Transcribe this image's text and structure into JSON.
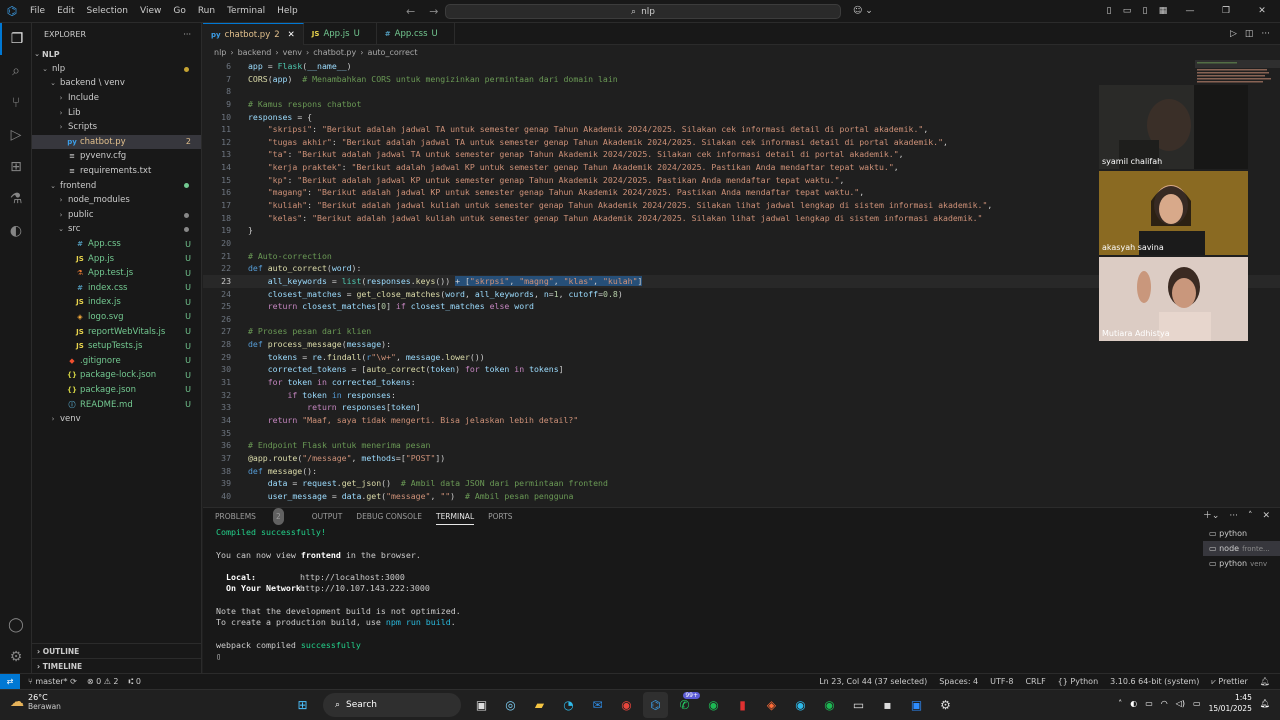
{
  "window": {
    "menu": [
      "File",
      "Edit",
      "Selection",
      "View",
      "Go",
      "Run",
      "Terminal",
      "Help"
    ],
    "search_text": "nlp",
    "nav_back": "←",
    "nav_forward": "→"
  },
  "explorer": {
    "title": "EXPLORER",
    "root": "NLP",
    "items": [
      {
        "label": "nlp",
        "indent": 1,
        "chev": "⌄",
        "icon": "",
        "color": "#cccccc",
        "badge": "",
        "dot": "#c5a332"
      },
      {
        "label": "backend \\ venv",
        "indent": 2,
        "chev": "⌄",
        "icon": "",
        "color": "#cccccc",
        "badge": "",
        "dot": ""
      },
      {
        "label": "Include",
        "indent": 3,
        "chev": "›",
        "icon": "",
        "color": "#cccccc",
        "badge": "",
        "dot": ""
      },
      {
        "label": "Lib",
        "indent": 3,
        "chev": "›",
        "icon": "",
        "color": "#cccccc",
        "badge": "",
        "dot": ""
      },
      {
        "label": "Scripts",
        "indent": 3,
        "chev": "›",
        "icon": "",
        "color": "#cccccc",
        "badge": "",
        "dot": ""
      },
      {
        "label": "chatbot.py",
        "indent": 3,
        "chev": "",
        "icon": "py",
        "color": "#e2c08d",
        "badge": "2",
        "dot": "",
        "sel": true
      },
      {
        "label": "pyvenv.cfg",
        "indent": 3,
        "chev": "",
        "icon": "≡",
        "color": "#cccccc",
        "badge": "",
        "dot": ""
      },
      {
        "label": "requirements.txt",
        "indent": 3,
        "chev": "",
        "icon": "≡",
        "color": "#cccccc",
        "badge": "",
        "dot": ""
      },
      {
        "label": "frontend",
        "indent": 2,
        "chev": "⌄",
        "icon": "",
        "color": "#cccccc",
        "badge": "",
        "dot": "#73c991"
      },
      {
        "label": "node_modules",
        "indent": 3,
        "chev": "›",
        "icon": "",
        "color": "#cccccc",
        "badge": "",
        "dot": ""
      },
      {
        "label": "public",
        "indent": 3,
        "chev": "›",
        "icon": "",
        "color": "#cccccc",
        "badge": "",
        "dot": "#888888"
      },
      {
        "label": "src",
        "indent": 3,
        "chev": "⌄",
        "icon": "",
        "color": "#cccccc",
        "badge": "",
        "dot": "#888888"
      },
      {
        "label": "App.css",
        "indent": 4,
        "chev": "",
        "icon": "#",
        "color": "#cccccc",
        "badge": "U",
        "dot": ""
      },
      {
        "label": "App.js",
        "indent": 4,
        "chev": "",
        "icon": "JS",
        "color": "#cccccc",
        "badge": "U",
        "dot": ""
      },
      {
        "label": "App.test.js",
        "indent": 4,
        "chev": "",
        "icon": "⚗",
        "color": "#cccccc",
        "badge": "U",
        "dot": ""
      },
      {
        "label": "index.css",
        "indent": 4,
        "chev": "",
        "icon": "#",
        "color": "#cccccc",
        "badge": "U",
        "dot": ""
      },
      {
        "label": "index.js",
        "indent": 4,
        "chev": "",
        "icon": "JS",
        "color": "#cccccc",
        "badge": "U",
        "dot": ""
      },
      {
        "label": "logo.svg",
        "indent": 4,
        "chev": "",
        "icon": "◈",
        "color": "#cccccc",
        "badge": "U",
        "dot": ""
      },
      {
        "label": "reportWebVitals.js",
        "indent": 4,
        "chev": "",
        "icon": "JS",
        "color": "#cccccc",
        "badge": "U",
        "dot": ""
      },
      {
        "label": "setupTests.js",
        "indent": 4,
        "chev": "",
        "icon": "JS",
        "color": "#cccccc",
        "badge": "U",
        "dot": ""
      },
      {
        "label": ".gitignore",
        "indent": 3,
        "chev": "",
        "icon": "◆",
        "color": "#cccccc",
        "badge": "U",
        "dot": ""
      },
      {
        "label": "package-lock.json",
        "indent": 3,
        "chev": "",
        "icon": "{}",
        "color": "#cccccc",
        "badge": "U",
        "dot": ""
      },
      {
        "label": "package.json",
        "indent": 3,
        "chev": "",
        "icon": "{}",
        "color": "#cccccc",
        "badge": "U",
        "dot": ""
      },
      {
        "label": "README.md",
        "indent": 3,
        "chev": "",
        "icon": "ⓘ",
        "color": "#cccccc",
        "badge": "U",
        "dot": ""
      },
      {
        "label": "venv",
        "indent": 2,
        "chev": "›",
        "icon": "",
        "color": "#cccccc",
        "badge": "",
        "dot": ""
      }
    ],
    "outline": "OUTLINE",
    "timeline": "TIMELINE"
  },
  "tabs": [
    {
      "label": "chatbot.py",
      "icon": "py",
      "suffix": "2",
      "active": true
    },
    {
      "label": "App.js",
      "icon": "JS",
      "suffix": "U",
      "active": false
    },
    {
      "label": "App.css",
      "icon": "#",
      "suffix": "U",
      "active": false
    }
  ],
  "breadcrumb": [
    "nlp",
    "backend",
    "venv",
    "chatbot.py",
    "auto_correct"
  ],
  "code_lines": [
    {
      "n": "6",
      "html": "<span class='var'>app</span> <span class='op'>=</span> <span class='cls'>Flask</span>(<span class='var'>__name__</span>)"
    },
    {
      "n": "7",
      "html": "<span class='fn'>CORS</span>(<span class='var'>app</span>)  <span class='cm'># Menambahkan CORS untuk mengizinkan permintaan dari domain lain</span>"
    },
    {
      "n": "8",
      "html": ""
    },
    {
      "n": "9",
      "html": "<span class='cm'># Kamus respons chatbot</span>"
    },
    {
      "n": "10",
      "html": "<span class='var'>responses</span> <span class='op'>=</span> {"
    },
    {
      "n": "11",
      "html": "    <span class='str'>\"skripsi\"</span>: <span class='str'>\"Berikut adalah jadwal TA untuk semester genap Tahun Akademik 2024/2025. Silakan cek informasi detail di portal akademik.\"</span>,"
    },
    {
      "n": "12",
      "html": "    <span class='str'>\"tugas akhir\"</span>: <span class='str'>\"Berikut adalah jadwal TA untuk semester genap Tahun Akademik 2024/2025. Silakan cek informasi detail di portal akademik.\"</span>,"
    },
    {
      "n": "13",
      "html": "    <span class='str'>\"ta\"</span>: <span class='str'>\"Berikut adalah jadwal TA untuk semester genap Tahun Akademik 2024/2025. Silakan cek informasi detail di portal akademik.\"</span>,"
    },
    {
      "n": "14",
      "html": "    <span class='str'>\"kerja praktek\"</span>: <span class='str'>\"Berikut adalah jadwal KP untuk semester genap Tahun Akademik 2024/2025. Pastikan Anda mendaftar tepat waktu.\"</span>,"
    },
    {
      "n": "15",
      "html": "    <span class='str'>\"kp\"</span>: <span class='str'>\"Berikut adalah jadwal KP untuk semester genap Tahun Akademik 2024/2025. Pastikan Anda mendaftar tepat waktu.\"</span>,"
    },
    {
      "n": "16",
      "html": "    <span class='str'>\"magang\"</span>: <span class='str'>\"Berikut adalah jadwal KP untuk semester genap Tahun Akademik 2024/2025. Pastikan Anda mendaftar tepat waktu.\"</span>,"
    },
    {
      "n": "17",
      "html": "    <span class='str'>\"kuliah\"</span>: <span class='str'>\"Berikut adalah jadwal kuliah untuk semester genap Tahun Akademik 2024/2025. Silakan lihat jadwal lengkap di sistem informasi akademik.\"</span>,"
    },
    {
      "n": "18",
      "html": "    <span class='str'>\"kelas\"</span>: <span class='str'>\"Berikut adalah jadwal kuliah untuk semester genap Tahun Akademik 2024/2025. Silakan lihat jadwal lengkap di sistem informasi akademik.\"</span>"
    },
    {
      "n": "19",
      "html": "}"
    },
    {
      "n": "20",
      "html": ""
    },
    {
      "n": "21",
      "html": "<span class='cm'># Auto-correction</span>"
    },
    {
      "n": "22",
      "html": "<span class='kb'>def</span> <span class='fn'>auto_correct</span>(<span class='var'>word</span>):"
    },
    {
      "n": "23",
      "html": "    <span class='var'>all_keywords</span> <span class='op'>=</span> <span class='cls'>list</span>(<span class='var'>responses</span>.<span class='fn'>keys</span>()) <span class='selbg'><span class='op'>+</span> [<span class='str'>\"skrpsi\"</span>, <span class='str'>\"magng\"</span>, <span class='str'>\"klas\"</span>, <span class='str'>\"kulah\"</span>]</span>",
      "cur": true
    },
    {
      "n": "24",
      "html": "    <span class='var'>closest_matches</span> <span class='op'>=</span> <span class='fn'>get_close_matches</span>(<span class='var'>word</span>, <span class='var'>all_keywords</span>, <span class='var'>n</span><span class='op'>=</span><span class='num'>1</span>, <span class='var'>cutoff</span><span class='op'>=</span><span class='num'>0.8</span>)"
    },
    {
      "n": "25",
      "html": "    <span class='kw'>return</span> <span class='var'>closest_matches</span>[<span class='num'>0</span>] <span class='kw'>if</span> <span class='var'>closest_matches</span> <span class='kw'>else</span> <span class='var'>word</span>"
    },
    {
      "n": "26",
      "html": ""
    },
    {
      "n": "27",
      "html": "<span class='cm'># Proses pesan dari klien</span>"
    },
    {
      "n": "28",
      "html": "<span class='kb'>def</span> <span class='fn'>process_message</span>(<span class='var'>message</span>):"
    },
    {
      "n": "29",
      "html": "    <span class='var'>tokens</span> <span class='op'>=</span> <span class='var'>re</span>.<span class='fn'>findall</span>(<span class='kb'>r</span><span class='str'>\"\\w+\"</span>, <span class='var'>message</span>.<span class='fn'>lower</span>())"
    },
    {
      "n": "30",
      "html": "    <span class='var'>corrected_tokens</span> <span class='op'>=</span> [<span class='fn'>auto_correct</span>(<span class='var'>token</span>) <span class='kw'>for</span> <span class='var'>token</span> <span class='kw'>in</span> <span class='var'>tokens</span>]"
    },
    {
      "n": "31",
      "html": "    <span class='kw'>for</span> <span class='var'>token</span> <span class='kw'>in</span> <span class='var'>corrected_tokens</span>:"
    },
    {
      "n": "32",
      "html": "        <span class='kw'>if</span> <span class='var'>token</span> <span class='kb'>in</span> <span class='var'>responses</span>:"
    },
    {
      "n": "33",
      "html": "            <span class='kw'>return</span> <span class='var'>responses</span>[<span class='var'>token</span>]"
    },
    {
      "n": "34",
      "html": "    <span class='kw'>return</span> <span class='str'>\"Maaf, saya tidak mengerti. Bisa jelaskan lebih detail?\"</span>"
    },
    {
      "n": "35",
      "html": ""
    },
    {
      "n": "36",
      "html": "<span class='cm'># Endpoint Flask untuk menerima pesan</span>"
    },
    {
      "n": "37",
      "html": "<span class='dec'>@app</span>.<span class='fn'>route</span>(<span class='str'>\"/message\"</span>, <span class='var'>methods</span><span class='op'>=</span>[<span class='str'>\"POST\"</span>])"
    },
    {
      "n": "38",
      "html": "<span class='kb'>def</span> <span class='fn'>message</span>():"
    },
    {
      "n": "39",
      "html": "    <span class='var'>data</span> <span class='op'>=</span> <span class='var'>request</span>.<span class='fn'>get_json</span>()  <span class='cm'># Ambil data JSON dari permintaan frontend</span>"
    },
    {
      "n": "40",
      "html": "    <span class='var'>user_message</span> <span class='op'>=</span> <span class='var'>data</span>.<span class='fn'>get</span>(<span class='str'>\"message\"</span>, <span class='str'>\"\"</span>)  <span class='cm'># Ambil pesan pengguna</span>"
    }
  ],
  "participants": [
    {
      "name": "syamil chalifah",
      "bg": "#2a2a28"
    },
    {
      "name": "akasyah savina",
      "bg": "#7a5e1e"
    },
    {
      "name": "Mutiara Adhistya",
      "bg": "#d9c7bd"
    }
  ],
  "panel": {
    "tabs": [
      "PROBLEMS",
      "OUTPUT",
      "DEBUG CONSOLE",
      "TERMINAL",
      "PORTS"
    ],
    "problems_count": "2",
    "active": "TERMINAL"
  },
  "terminal": {
    "compiled": "Compiled successfully!",
    "view_pre": "You can now view ",
    "view_app": "frontend",
    "view_post": " in the browser.",
    "local_label": "  Local:",
    "local_url": "http://localhost:3000",
    "network_label": "  On Your Network:",
    "network_url": "http://10.107.143.222:3000",
    "note1": "Note that the development build is not optimized.",
    "note2_pre": "To create a production build, use ",
    "note2_cmd": "npm run build",
    "note2_post": ".",
    "webpack_pre": "webpack compiled ",
    "webpack_status": "successfully"
  },
  "terminal_list": [
    {
      "name": "python",
      "sub": "",
      "active": false
    },
    {
      "name": "node",
      "sub": "fronte...",
      "active": true
    },
    {
      "name": "python",
      "sub": "venv",
      "active": false
    }
  ],
  "status": {
    "branch": "master*",
    "errors": "0",
    "warnings": "2",
    "ports": "0",
    "position": "Ln 23, Col 44 (37 selected)",
    "spaces": "Spaces: 4",
    "encoding": "UTF-8",
    "eol": "CRLF",
    "language": "Python",
    "interpreter": "3.10.6 64-bit (system)",
    "prettier": "Prettier"
  },
  "taskbar": {
    "temp": "26°C",
    "weather": "Berawan",
    "search": "Search",
    "time": "1:45",
    "date": "15/01/2025",
    "notif": "99+"
  }
}
